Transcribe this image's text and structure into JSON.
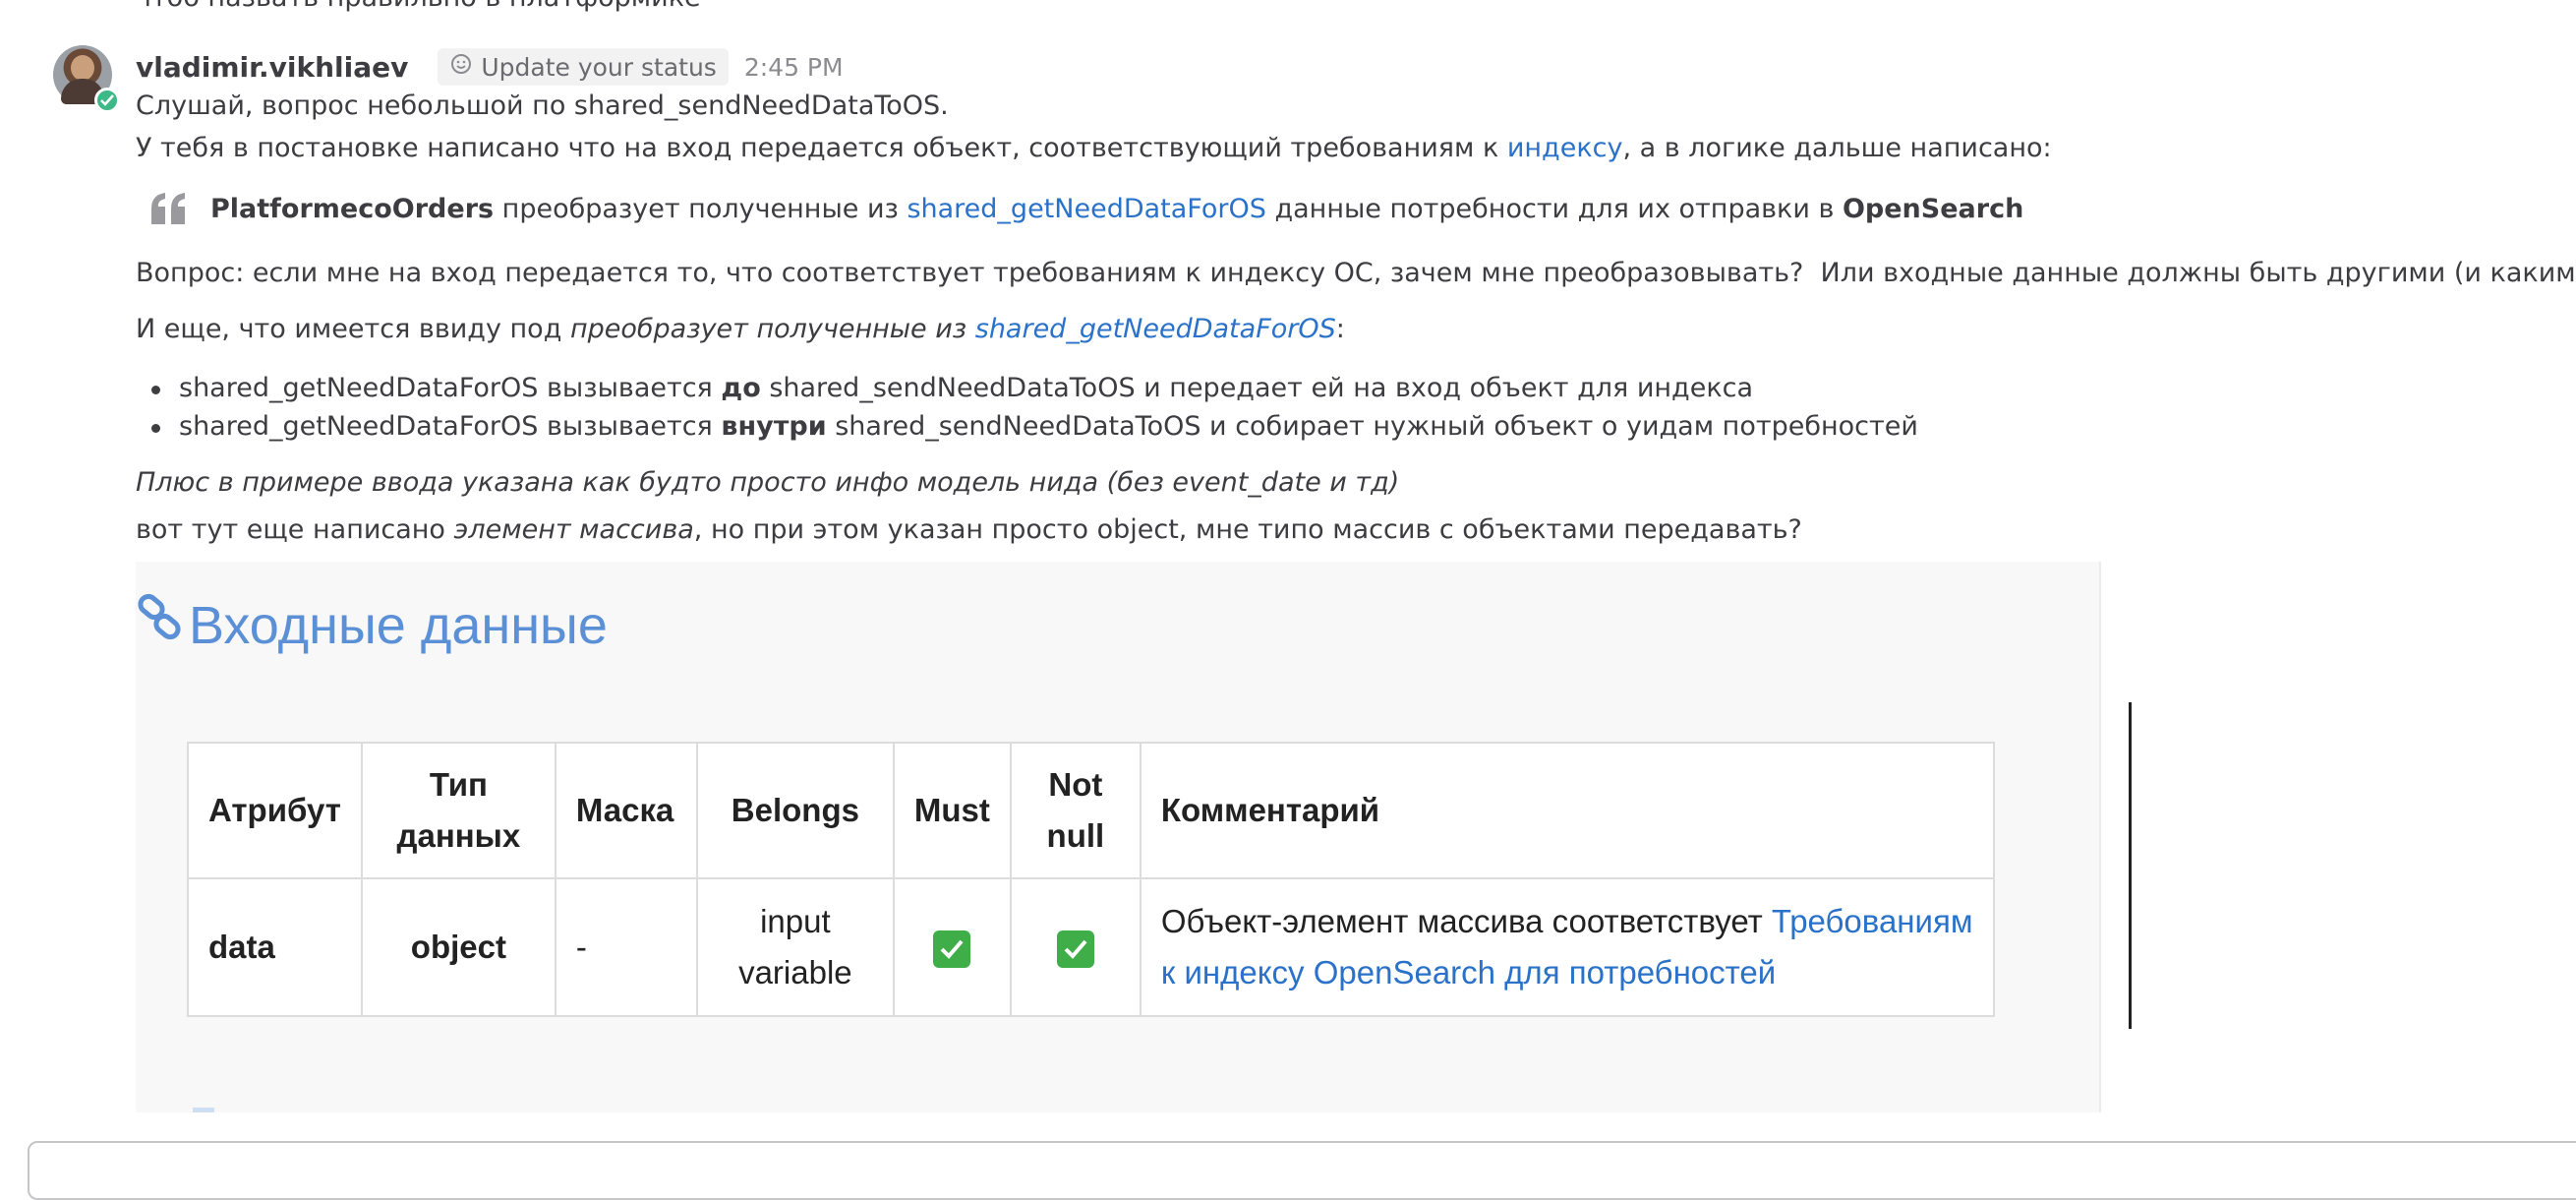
{
  "previous_message": {
    "text": "чтоб назвать правильно в платформике"
  },
  "message": {
    "author": "vladimir.vikhliaev",
    "status_button": "Update your status",
    "time": "2:45 PM",
    "line1": "Слушай, вопрос небольшой по shared_sendNeedDataToOS.",
    "line2_before": "У тебя в постановке написано что на вход передается объект, соответствующий требованиям к ",
    "line2_link": "индексу",
    "line2_after": ", а в логике дальше написано:",
    "quote": {
      "bold1": "PlatformecoOrders",
      "text1": " преобразует полученные из ",
      "link": "shared_getNeedDataForOS",
      "text2": " данные потребности для их отправки в ",
      "bold2": "OpenSearch"
    },
    "question": "Вопрос: если мне на вход передается то, что соответствует требованиям к индексу ОС, зачем мне преобразовывать?  Или входные данные должны быть другими (и какими)?",
    "also_before": "И еще, что имеется ввиду под ",
    "also_italic": "преобразует полученные из ",
    "also_link": "shared_getNeedDataForOS",
    "also_after": ":",
    "bullets": [
      {
        "pre": "shared_getNeedDataForOS вызывается ",
        "bold": "до",
        "post": " shared_sendNeedDataToOS и передает ей на вход объект для индекса"
      },
      {
        "pre": "shared_getNeedDataForOS вызывается ",
        "bold": "внутри",
        "post": " shared_sendNeedDataToOS и собирает нужный объект о уидам потребностей"
      }
    ],
    "italic_note": "Плюс в примере ввода указана как будто просто инфо модель нида (без event_date и тд)",
    "last_before": "вот тут еще написано ",
    "last_italic": "элемент массива",
    "last_after": ", но при этом указан просто object, мне типо массив с объектами передавать?"
  },
  "embedded_image": {
    "title": "Входные данные",
    "headers": {
      "attr": "Атрибут",
      "type_l1": "Тип",
      "type_l2": "данных",
      "mask": "Маска",
      "belongs": "Belongs",
      "must": "Must",
      "notnull_l1": "Not",
      "notnull_l2": "null",
      "comment": "Комментарий"
    },
    "row": {
      "attr": "data",
      "type": "object",
      "mask": "-",
      "belongs_l1": "input",
      "belongs_l2": "variable",
      "must": "checked",
      "notnull": "checked",
      "comment_text": "Объект-элемент массива соответствует ",
      "comment_link_l1": "Требованиям",
      "comment_link_l2": "к индексу OpenSearch для потребностей"
    }
  },
  "colors": {
    "link": "#2a72c9",
    "online": "#3db887",
    "embed_title": "#5b8fd6",
    "check": "#3fae49"
  }
}
